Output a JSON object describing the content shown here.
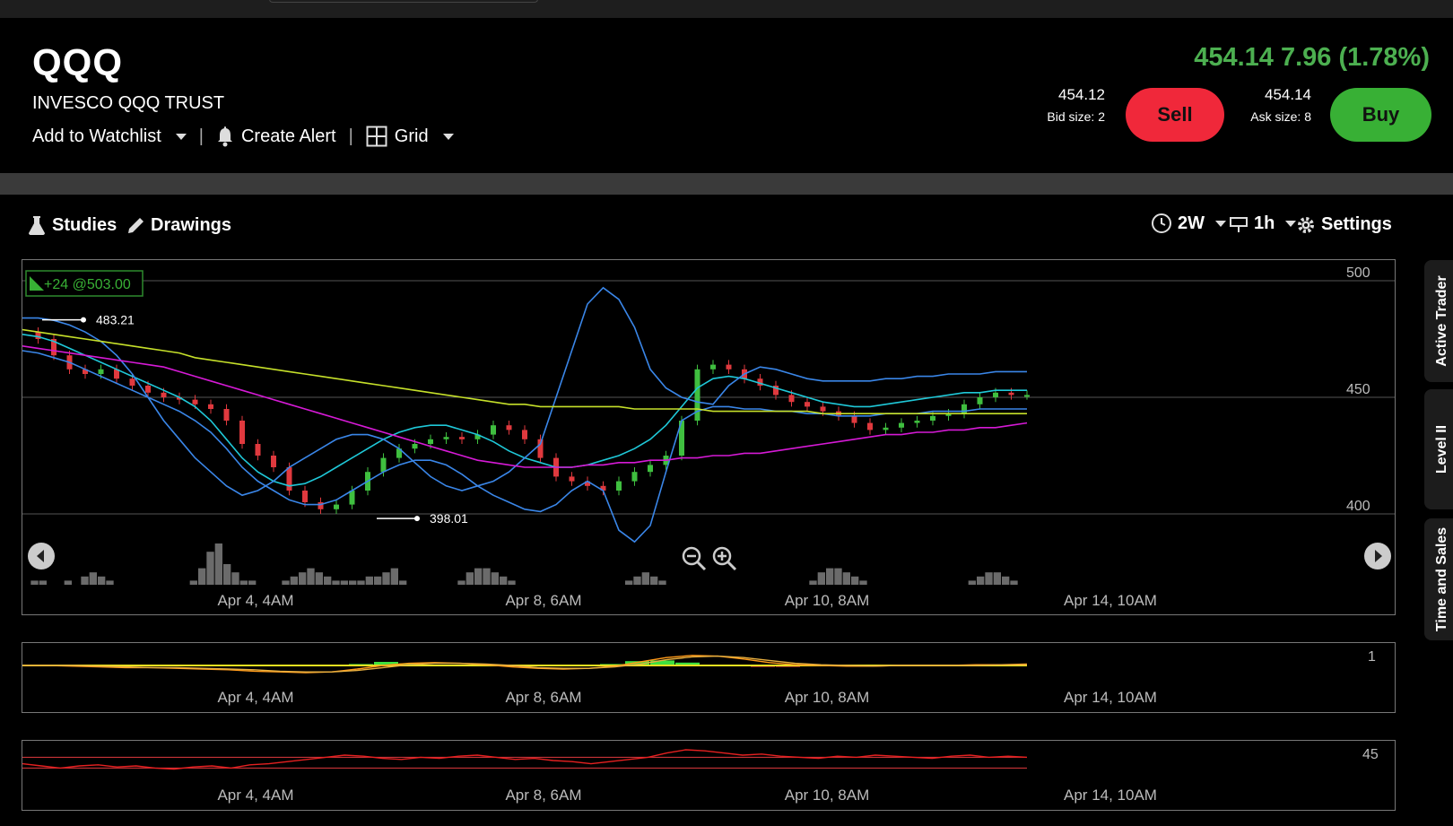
{
  "header": {
    "symbol": "QQQ",
    "name": "INVESCO QQQ TRUST",
    "watchlist_label": "Add to Watchlist",
    "alert_label": "Create Alert",
    "grid_label": "Grid",
    "price_line": "454.14 7.96 (1.78%)",
    "bid_price": "454.12",
    "bid_size": "Bid size: 2",
    "sell_label": "Sell",
    "ask_price": "454.14",
    "ask_size": "Ask size: 8",
    "buy_label": "Buy",
    "price_color": "#4caf50",
    "sell_color": "#f0283a",
    "buy_color": "#38b035"
  },
  "toolbar": {
    "studies_label": "Studies",
    "drawings_label": "Drawings",
    "range_label": "2W",
    "interval_label": "1h",
    "settings_label": "Settings"
  },
  "side_tabs": [
    "Active Trader",
    "Level II",
    "Time and Sales"
  ],
  "chart_data": [
    {
      "type": "line",
      "title": "",
      "x_tick_labels": [
        "Apr 4, 4AM",
        "Apr 8, 6AM",
        "Apr 10, 8AM",
        "Apr 14, 10AM"
      ],
      "y_ticks": [
        400,
        450,
        500
      ],
      "ylim": [
        380,
        505
      ],
      "grid": true,
      "position_badge": "+24 @503.00",
      "high_label": "483.21",
      "low_label": "398.01",
      "series": [
        {
          "values": [
            478,
            475,
            468,
            462,
            460,
            462,
            458,
            455,
            452,
            450,
            449,
            447,
            445,
            440,
            430,
            425,
            420,
            410,
            405,
            402,
            404,
            410,
            418,
            424,
            428,
            430,
            432,
            433,
            432,
            434,
            438,
            436,
            432,
            424,
            416,
            414,
            412,
            410,
            414,
            418,
            421,
            425,
            440,
            462,
            464,
            462,
            458,
            455,
            451,
            448,
            446,
            444,
            442,
            439,
            436,
            437,
            439,
            440,
            442,
            443,
            447,
            450,
            452,
            451,
            451
          ]
        },
        {
          "values": [
            477,
            476,
            474,
            471,
            468,
            465,
            462,
            459,
            456,
            453,
            450,
            446,
            440,
            432,
            424,
            418,
            414,
            412,
            413,
            416,
            420,
            424,
            428,
            432,
            435,
            437,
            438,
            438,
            436,
            434,
            431,
            427,
            424,
            422,
            420,
            420,
            421,
            423,
            425,
            428,
            432,
            438,
            446,
            454,
            458,
            459,
            458,
            456,
            454,
            452,
            450,
            448,
            447,
            446,
            446,
            447,
            448,
            449,
            450,
            451,
            452,
            452,
            453,
            453,
            453
          ]
        },
        {
          "values": [
            484,
            484,
            483,
            481,
            478,
            474,
            468,
            460,
            450,
            440,
            432,
            424,
            418,
            412,
            408,
            410,
            414,
            420,
            424,
            428,
            432,
            434,
            434,
            432,
            428,
            422,
            416,
            412,
            410,
            412,
            414,
            418,
            424,
            430,
            450,
            470,
            490,
            497,
            492,
            480,
            462,
            454,
            450,
            448,
            447,
            455,
            460,
            463,
            462,
            460,
            458,
            457,
            457,
            457,
            457,
            458,
            458,
            459,
            459,
            460,
            460,
            460,
            461,
            461,
            461
          ]
        },
        {
          "values": [
            470,
            469,
            467,
            465,
            462,
            459,
            456,
            453,
            450,
            447,
            444,
            440,
            435,
            428,
            420,
            414,
            410,
            406,
            404,
            404,
            406,
            410,
            414,
            418,
            421,
            423,
            423,
            421,
            417,
            412,
            408,
            405,
            402,
            401,
            404,
            410,
            414,
            410,
            393,
            388,
            395,
            418,
            440,
            444,
            446,
            446,
            445,
            445,
            444,
            444,
            443,
            443,
            442,
            442,
            442,
            443,
            443,
            443,
            444,
            444,
            444,
            445,
            445,
            445,
            445
          ]
        },
        {
          "values": [
            479,
            478,
            477,
            476,
            475,
            474,
            473,
            472,
            471,
            470,
            469,
            467,
            466,
            465,
            464,
            463,
            462,
            461,
            460,
            459,
            458,
            457,
            456,
            455,
            454,
            453,
            452,
            451,
            450,
            449,
            448,
            447,
            447,
            446,
            446,
            446,
            446,
            446,
            446,
            445,
            445,
            445,
            445,
            445,
            444,
            444,
            444,
            444,
            444,
            444,
            444,
            443,
            443,
            443,
            443,
            443,
            443,
            443,
            443,
            443,
            443,
            443,
            443,
            443,
            443
          ]
        },
        {
          "values": [
            472,
            471,
            470,
            469,
            468,
            467,
            466,
            465,
            464,
            463,
            461,
            459,
            457,
            455,
            453,
            451,
            449,
            447,
            445,
            443,
            441,
            439,
            437,
            435,
            433,
            431,
            429,
            427,
            425,
            423,
            422,
            421,
            420,
            420,
            420,
            420,
            421,
            421,
            422,
            422,
            423,
            423,
            424,
            424,
            425,
            425,
            426,
            426,
            427,
            428,
            429,
            430,
            431,
            432,
            433,
            434,
            434,
            435,
            435,
            436,
            436,
            437,
            437,
            438,
            439
          ]
        }
      ],
      "volume": [
        0,
        1,
        1,
        0,
        0,
        1,
        0,
        2,
        3,
        2,
        1,
        0,
        0,
        0,
        0,
        0,
        0,
        0,
        0,
        0,
        1,
        4,
        8,
        10,
        5,
        3,
        1,
        1,
        0,
        0,
        0,
        1,
        2,
        3,
        4,
        3,
        2,
        1,
        1,
        1,
        1,
        2,
        2,
        3,
        4,
        1,
        0,
        0,
        0,
        0,
        0,
        0,
        1,
        3,
        4,
        4,
        3,
        2,
        1,
        0,
        0,
        0,
        0,
        0,
        0,
        0,
        0,
        0,
        0,
        0,
        0,
        0,
        1,
        2,
        3,
        2,
        1,
        0,
        0,
        0,
        0,
        0,
        0,
        0,
        0,
        0,
        0,
        0,
        0,
        0,
        0,
        0,
        0,
        0,
        1,
        3,
        4,
        4,
        3,
        2,
        1,
        0,
        0,
        0,
        0,
        0,
        0,
        0,
        0,
        0,
        0,
        0,
        0,
        1,
        2,
        3,
        3,
        2,
        1,
        0
      ]
    },
    {
      "type": "line",
      "title": "",
      "x_tick_labels": [
        "Apr 4, 4AM",
        "Apr 8, 6AM",
        "Apr 10, 8AM",
        "Apr 14, 10AM"
      ],
      "y_ticks": [
        1
      ],
      "ylim": [
        -1.5,
        1.5
      ],
      "series": [
        {
          "values": [
            0,
            0,
            -0.1,
            -0.2,
            -0.3,
            -0.3,
            -0.4,
            -0.5,
            -0.6,
            -0.8,
            -0.9,
            -1.0,
            -0.9,
            -0.5,
            0,
            0.3,
            0.4,
            0.3,
            0.1,
            -0.2,
            -0.4,
            -0.5,
            -0.4,
            -0.1,
            0.5,
            1.1,
            1.4,
            1.3,
            0.9,
            0.4,
            0.1,
            0,
            -0.1,
            -0.1,
            0,
            0,
            0,
            0.1,
            0.1,
            0.2
          ]
        },
        {
          "values": [
            0,
            0,
            0,
            -0.1,
            -0.2,
            -0.3,
            -0.3,
            -0.4,
            -0.5,
            -0.6,
            -0.8,
            -0.9,
            -0.9,
            -0.7,
            -0.3,
            0.1,
            0.3,
            0.3,
            0.2,
            0,
            -0.3,
            -0.4,
            -0.4,
            -0.2,
            0.2,
            0.8,
            1.2,
            1.3,
            1.1,
            0.7,
            0.3,
            0.1,
            0,
            -0.1,
            0,
            0,
            0,
            0,
            0.1,
            0.1
          ]
        }
      ],
      "histogram": [
        0,
        0,
        0,
        0,
        0,
        0,
        0,
        0,
        0,
        0,
        -0.1,
        -0.1,
        0,
        0.2,
        0.5,
        0.3,
        0.1,
        0,
        -0.1,
        -0.1,
        0,
        0,
        0,
        0.2,
        0.6,
        0.7,
        0.4,
        0.1,
        -0.1,
        -0.2,
        -0.2,
        -0.1,
        0,
        0,
        0,
        0,
        0,
        0,
        0,
        0
      ]
    },
    {
      "type": "line",
      "title": "",
      "x_tick_labels": [
        "Apr 4, 4AM",
        "Apr 8, 6AM",
        "Apr 10, 8AM",
        "Apr 14, 10AM"
      ],
      "y_ticks": [
        45
      ],
      "ylim": [
        25,
        60
      ],
      "series": [
        {
          "values": [
            42,
            40,
            38,
            40,
            41,
            39,
            40,
            38,
            37,
            39,
            40,
            38,
            41,
            42,
            44,
            46,
            48,
            50,
            49,
            47,
            46,
            48,
            47,
            49,
            50,
            48,
            46,
            47,
            45,
            44,
            42,
            44,
            46,
            48,
            52,
            55,
            54,
            52,
            50,
            51,
            49,
            48,
            47,
            49,
            48,
            50,
            49,
            48,
            47,
            49,
            50,
            48,
            49,
            48
          ]
        }
      ],
      "bands": [
        38,
        48
      ]
    }
  ]
}
